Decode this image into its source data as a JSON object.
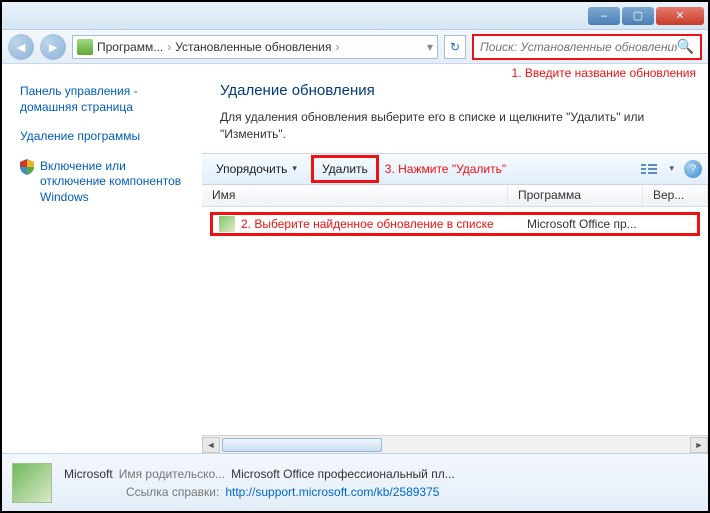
{
  "titlebar": {
    "min": "–",
    "max": "▢",
    "close": "✕"
  },
  "nav": {
    "back": "◄",
    "fwd": "►",
    "crumb1": "Программ...",
    "sep": "›",
    "crumb2": "Установленные обновления",
    "refresh": "↻"
  },
  "search": {
    "placeholder": "Поиск: Установленные обновления",
    "icon": "🔍"
  },
  "annot1": "1. Введите название обновления",
  "sidebar": {
    "home": "Панель управления - домашняя страница",
    "uninstall": "Удаление программы",
    "winfeat": "Включение или отключение компонентов Windows"
  },
  "main": {
    "title": "Удаление обновления",
    "desc": "Для удаления обновления выберите его в списке и щелкните \"Удалить\" или \"Изменить\"."
  },
  "toolbar": {
    "organize": "Упорядочить",
    "delete": "Удалить",
    "annot3": "3. Нажмите \"Удалить\"",
    "help": "?"
  },
  "columns": {
    "name": "Имя",
    "program": "Программа",
    "version": "Вер..."
  },
  "row": {
    "annot2": "2. Выберите найденное обновление в списке",
    "program": "Microsoft Office пр..."
  },
  "details": {
    "vendor": "Microsoft",
    "parent_label": "Имя родительско...",
    "parent_val": "Microsoft Office профессиональный пл...",
    "help_label": "Ссылка справки:",
    "help_url": "http://support.microsoft.com/kb/2589375"
  }
}
